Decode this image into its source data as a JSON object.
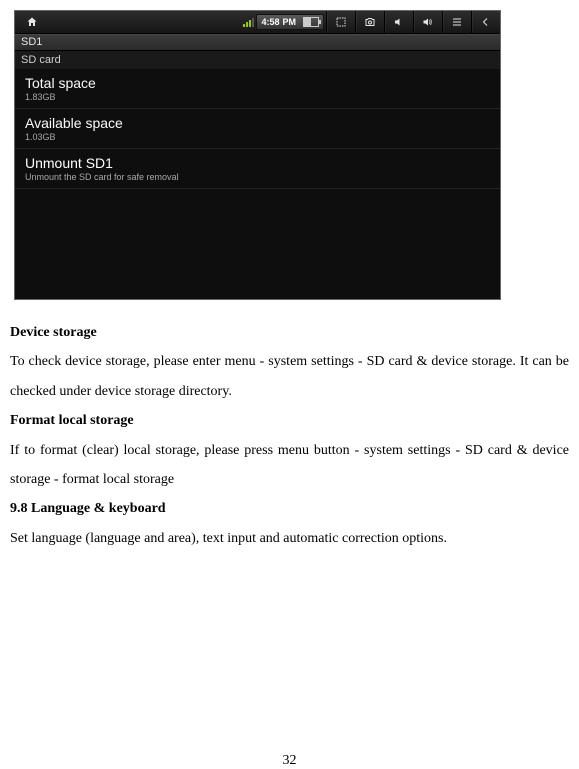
{
  "statusbar": {
    "time": "4:58",
    "ampm": "PM"
  },
  "sd": {
    "tab": "SD1",
    "section": "SD card",
    "items": [
      {
        "title": "Total space",
        "sub": "1.83GB"
      },
      {
        "title": "Available space",
        "sub": "1.03GB"
      },
      {
        "title": "Unmount SD1",
        "sub": "Unmount the SD card for safe removal"
      }
    ]
  },
  "doc": {
    "h1": "Device storage",
    "p1": "To check device storage, please enter menu - system settings - SD card & device storage. It can be checked under device storage directory.",
    "h2": "Format local storage",
    "p2": "If to format (clear) local storage, please press menu button - system settings - SD card & device storage - format local storage",
    "h3": "9.8 Language & keyboard",
    "p3": "Set language (language and area), text input and automatic correction options.",
    "page": "32"
  }
}
